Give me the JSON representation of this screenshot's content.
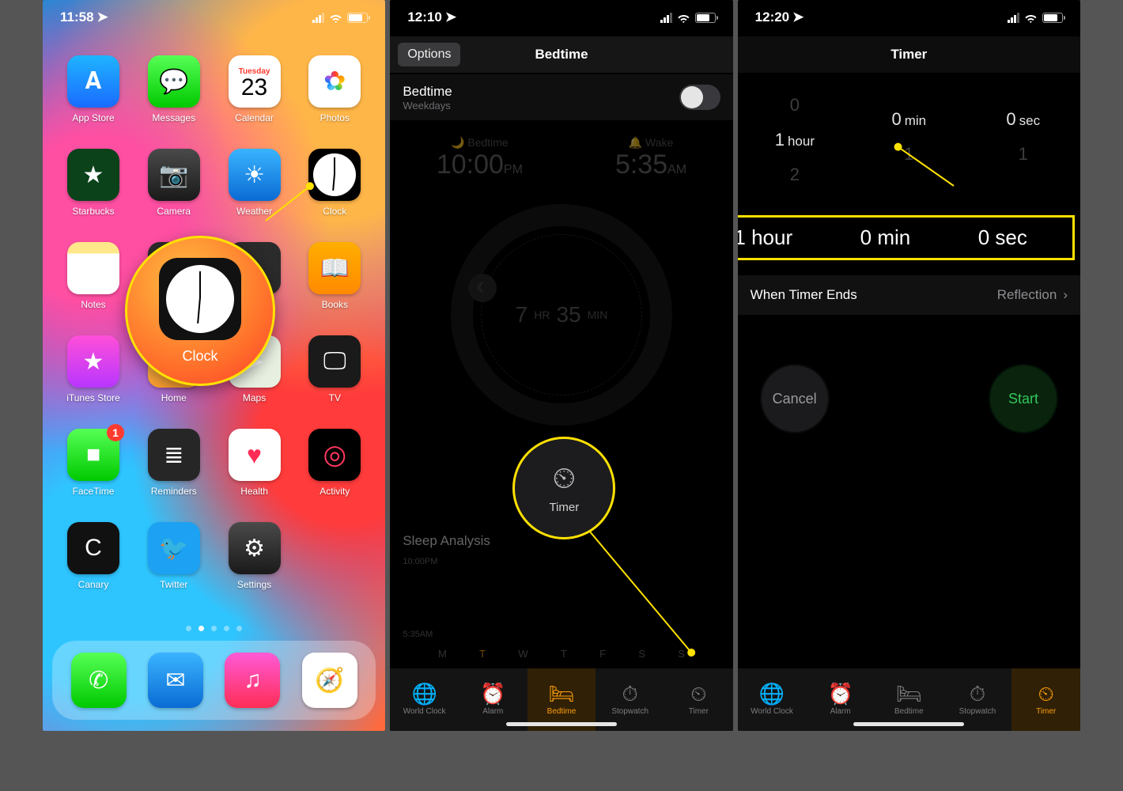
{
  "phone1": {
    "status_time": "11:58",
    "apps": [
      [
        {
          "key": "appstore",
          "label": "App Store",
          "cls": "i-appstore",
          "glyph": "𝐀"
        },
        {
          "key": "messages",
          "label": "Messages",
          "cls": "i-msg",
          "glyph": "💬"
        },
        {
          "key": "calendar",
          "label": "Calendar",
          "cls": "i-cal"
        },
        {
          "key": "photos",
          "label": "Photos",
          "cls": "i-photos",
          "glyph": "✿"
        }
      ],
      [
        {
          "key": "starbucks",
          "label": "Starbucks",
          "cls": "i-sbux",
          "glyph": "★"
        },
        {
          "key": "camera",
          "label": "Camera",
          "cls": "i-cam",
          "glyph": "📷"
        },
        {
          "key": "weather",
          "label": "Weather",
          "cls": "i-weather",
          "glyph": "☀"
        },
        {
          "key": "clock",
          "label": "Clock",
          "cls": "i-clock"
        }
      ],
      [
        {
          "key": "notes",
          "label": "Notes",
          "cls": "i-notes",
          "glyph": ""
        },
        {
          "key": "contacts",
          "label": "",
          "cls": "i-contacts",
          "glyph": "👤"
        },
        {
          "key": "hidden",
          "label": "",
          "cls": "i-contacts",
          "glyph": ""
        },
        {
          "key": "books",
          "label": "Books",
          "cls": "i-books",
          "glyph": "📖"
        }
      ],
      [
        {
          "key": "itunes",
          "label": "iTunes Store",
          "cls": "i-itunes",
          "glyph": "★"
        },
        {
          "key": "home",
          "label": "Home",
          "cls": "i-home",
          "glyph": "⌂"
        },
        {
          "key": "maps",
          "label": "Maps",
          "cls": "i-maps",
          "glyph": "➤"
        },
        {
          "key": "tv",
          "label": "TV",
          "cls": "i-tv",
          "glyph": "🖵"
        }
      ],
      [
        {
          "key": "facetime",
          "label": "FaceTime",
          "cls": "i-ft",
          "glyph": "■",
          "badge": "1"
        },
        {
          "key": "reminders",
          "label": "Reminders",
          "cls": "i-rem",
          "glyph": "≣"
        },
        {
          "key": "health",
          "label": "Health",
          "cls": "i-health",
          "glyph": "♥"
        },
        {
          "key": "activity",
          "label": "Activity",
          "cls": "i-act",
          "glyph": "◎"
        }
      ],
      [
        {
          "key": "canary",
          "label": "Canary",
          "cls": "i-canary",
          "glyph": "C"
        },
        {
          "key": "twitter",
          "label": "Twitter",
          "cls": "i-tw",
          "glyph": "🐦"
        },
        {
          "key": "settings",
          "label": "Settings",
          "cls": "i-set",
          "glyph": "⚙"
        },
        {
          "key": "blank",
          "label": "",
          "cls": "",
          "glyph": ""
        }
      ]
    ],
    "calendar_dow": "Tuesday",
    "calendar_day": "23",
    "dock": [
      {
        "key": "phone",
        "cls": "i-phone",
        "glyph": "✆"
      },
      {
        "key": "mail",
        "cls": "i-mail",
        "glyph": "✉"
      },
      {
        "key": "music",
        "cls": "i-music",
        "glyph": "♫"
      },
      {
        "key": "safari",
        "cls": "i-safari",
        "glyph": "🧭"
      }
    ],
    "magnifier_label": "Clock"
  },
  "phone2": {
    "status_time": "12:10",
    "options_btn": "Options",
    "title": "Bedtime",
    "bedtime_label": "Bedtime",
    "bedtime_sub": "Weekdays",
    "bedtime_header": "🌙 Bedtime",
    "wake_header": "🔔 Wake",
    "bedtime_time": "10:00",
    "bedtime_ampm": "PM",
    "wake_time": "5:35",
    "wake_ampm": "AM",
    "duration_hr": "7",
    "duration_hr_u": "HR",
    "duration_min": "35",
    "duration_min_u": "MIN",
    "sleep_analysis": "Sleep Analysis",
    "sa_top": "10:00PM",
    "sa_bot": "5:35AM",
    "days": [
      "M",
      "T",
      "W",
      "T",
      "F",
      "S",
      "S"
    ],
    "day_selected_index": 1,
    "tabs": [
      {
        "key": "worldclock",
        "label": "World Clock",
        "glyph": "🌐"
      },
      {
        "key": "alarm",
        "label": "Alarm",
        "glyph": "⏰"
      },
      {
        "key": "bedtime",
        "label": "Bedtime",
        "glyph": "🛏"
      },
      {
        "key": "stopwatch",
        "label": "Stopwatch",
        "glyph": "⏱"
      },
      {
        "key": "timer",
        "label": "Timer",
        "glyph": "⏲"
      }
    ],
    "active_tab": "bedtime",
    "magnifier_label": "Timer"
  },
  "phone3": {
    "status_time": "12:20",
    "title": "Timer",
    "picker": {
      "hours": {
        "above": "0",
        "sel": "1",
        "below": "2",
        "unit": "hour"
      },
      "mins": {
        "above": "",
        "sel": "0",
        "below": "1",
        "unit": "min"
      },
      "secs": {
        "above": "",
        "sel": "0",
        "below": "1",
        "unit": "sec"
      }
    },
    "callout": {
      "h": "1 hour",
      "m": "0 min",
      "s": "0 sec"
    },
    "ends_label": "When Timer Ends",
    "ends_value": "Reflection",
    "cancel": "Cancel",
    "start": "Start",
    "tabs": [
      {
        "key": "worldclock",
        "label": "World Clock",
        "glyph": "🌐"
      },
      {
        "key": "alarm",
        "label": "Alarm",
        "glyph": "⏰"
      },
      {
        "key": "bedtime",
        "label": "Bedtime",
        "glyph": "🛏"
      },
      {
        "key": "stopwatch",
        "label": "Stopwatch",
        "glyph": "⏱"
      },
      {
        "key": "timer",
        "label": "Timer",
        "glyph": "⏲"
      }
    ],
    "active_tab": "timer"
  }
}
